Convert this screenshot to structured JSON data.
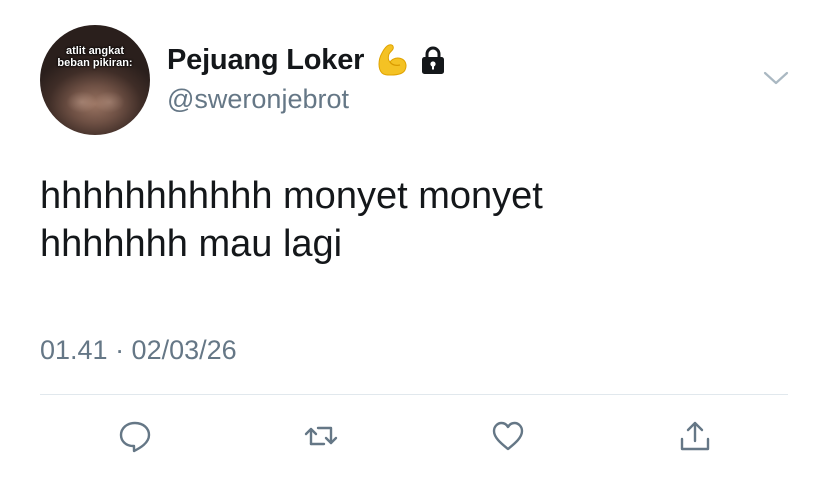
{
  "user": {
    "display_name": "Pejuang Loker",
    "handle": "@sweronjebrot",
    "avatar_caption_line1": "atlit angkat",
    "avatar_caption_line2": "beban pikiran:",
    "name_emoji": "flexed-biceps-emoji",
    "protected_icon": "lock-icon"
  },
  "tweet": {
    "text_line1": "hhhhhhhhhhh monyet monyet",
    "text_line2": "hhhhhhh mau lagi",
    "timestamp": "01.41 · 02/03/26"
  },
  "menu_icon": "chevron-down-icon",
  "actions": [
    {
      "name": "reply",
      "icon": "speech-bubble-icon"
    },
    {
      "name": "retweet",
      "icon": "retweet-icon"
    },
    {
      "name": "like",
      "icon": "heart-icon"
    },
    {
      "name": "share",
      "icon": "share-icon"
    }
  ],
  "colors": {
    "text": "#14171a",
    "secondary": "#657786",
    "icon": "#657786",
    "divider": "#e1e8ed",
    "background": "#ffffff"
  }
}
